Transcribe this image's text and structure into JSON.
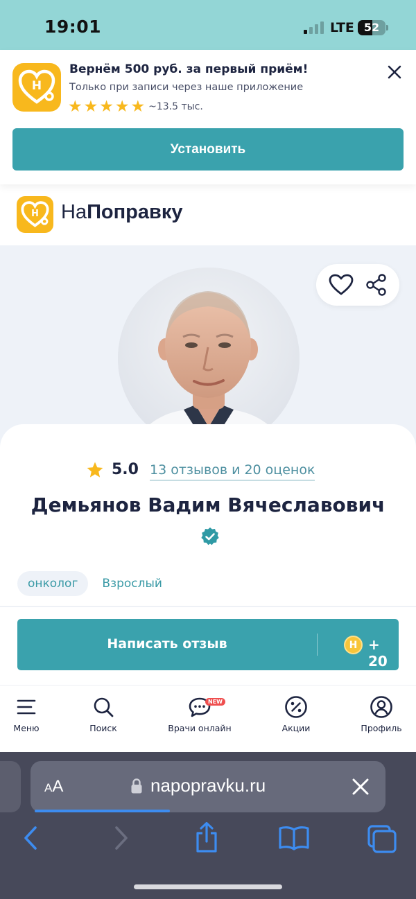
{
  "status_bar": {
    "time": "19:01",
    "network": "LTE",
    "battery": "52",
    "battery_level": 0.52
  },
  "promo_banner": {
    "title": "Вернём 500 руб. за первый приём!",
    "subtitle": "Только при записи через наше приложение",
    "rating_stars": 5,
    "ratings_count": "~13.5 тыс.",
    "install_label": "Установить",
    "icon": "close-icon"
  },
  "site_header": {
    "logo_light": "На",
    "logo_bold": "Поправку"
  },
  "doctor": {
    "rating": "5.0",
    "reviews_link": "13 отзывов и 20 оценок",
    "name": "Демьянов Вадим Вячеславович",
    "verified": true,
    "tags": [
      "онколог",
      "Взрослый"
    ]
  },
  "review_button": {
    "label": "Написать отзыв",
    "coin_symbol": "Н",
    "bonus": "+ 20"
  },
  "bottom_nav": [
    {
      "label": "Меню",
      "icon": "menu-icon"
    },
    {
      "label": "Поиск",
      "icon": "search-icon"
    },
    {
      "label": "Врачи онлайн",
      "icon": "chat-icon",
      "badge": "NEW"
    },
    {
      "label": "Акции",
      "icon": "percent-icon"
    },
    {
      "label": "Профиль",
      "icon": "profile-icon"
    }
  ],
  "browser": {
    "text_size_label_small": "A",
    "text_size_label_large": "A",
    "url": "napopravku.ru",
    "load_progress": 0.38
  },
  "colors": {
    "accent": "#3aa2ad",
    "brand_yellow": "#f8b81d",
    "status_bar": "#93d6d6",
    "text_dark": "#1d2440"
  }
}
